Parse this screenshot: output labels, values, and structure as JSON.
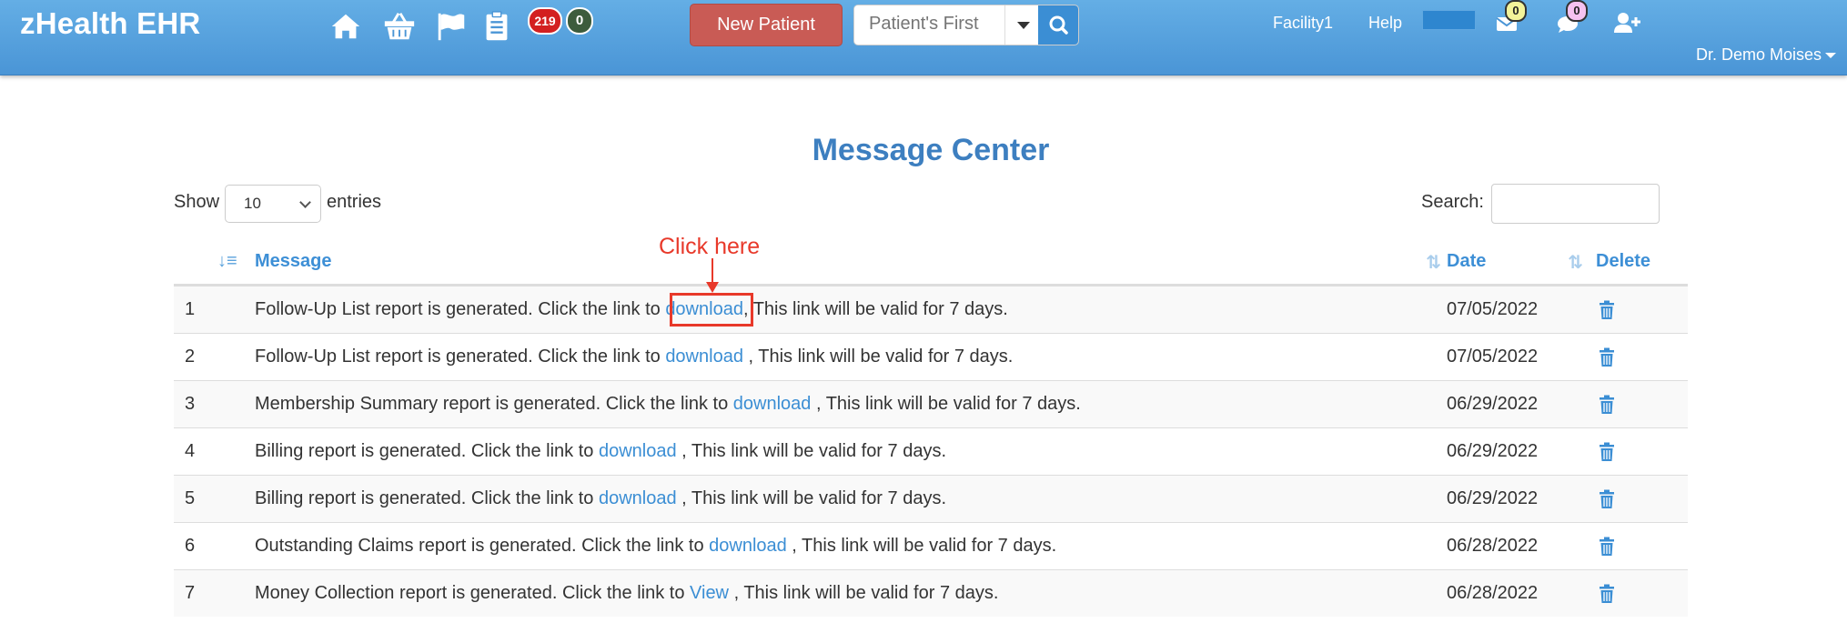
{
  "app": {
    "brand": "zHealth EHR",
    "badges": {
      "alerts": "219",
      "notifications": "0"
    },
    "new_patient_label": "New Patient",
    "search_placeholder": "Patient's First",
    "facility": "Facility1",
    "help": "Help",
    "mail_count": "0",
    "chat_count": "0",
    "user": "Dr. Demo Moises"
  },
  "page": {
    "title": "Message Center",
    "show_label": "Show",
    "entries_value": "10",
    "entries_label": "entries",
    "search_label": "Search:"
  },
  "table": {
    "headers": {
      "message": "Message",
      "date": "Date",
      "delete": "Delete"
    },
    "rows": [
      {
        "num": "1",
        "pre": "Follow-Up List report is generated. Click the link to ",
        "link": "download",
        "post": ", This link will be valid for 7 days.",
        "date": "07/05/2022"
      },
      {
        "num": "2",
        "pre": "Follow-Up List report is generated. Click the link to ",
        "link": "download",
        "post": " , This link will be valid for 7 days.",
        "date": "07/05/2022"
      },
      {
        "num": "3",
        "pre": "Membership Summary report is generated. Click the link to ",
        "link": "download",
        "post": " , This link will be valid for 7 days.",
        "date": "06/29/2022"
      },
      {
        "num": "4",
        "pre": "Billing report is generated. Click the link to ",
        "link": "download",
        "post": " , This link will be valid for 7 days.",
        "date": "06/29/2022"
      },
      {
        "num": "5",
        "pre": "Billing report is generated. Click the link to ",
        "link": "download",
        "post": " , This link will be valid for 7 days.",
        "date": "06/29/2022"
      },
      {
        "num": "6",
        "pre": "Outstanding Claims report is generated. Click the link to ",
        "link": "download",
        "post": " , This link will be valid for 7 days.",
        "date": "06/28/2022"
      },
      {
        "num": "7",
        "pre": "Money Collection report is generated. Click the link to ",
        "link": "View",
        "post": " , This link will be valid for 7 days.",
        "date": "06/28/2022"
      }
    ]
  },
  "annotation": {
    "text": "Click here"
  },
  "colors": {
    "navbar": "#4a95d6",
    "accent": "#3b8ed4",
    "new_patient": "#c95b55",
    "annotation": "#e8392a"
  },
  "icons": [
    "home-icon",
    "basket-icon",
    "flag-icon",
    "clipboard-icon",
    "search-icon",
    "envelope-icon",
    "comment-icon",
    "user-plus-icon",
    "trash-icon"
  ]
}
